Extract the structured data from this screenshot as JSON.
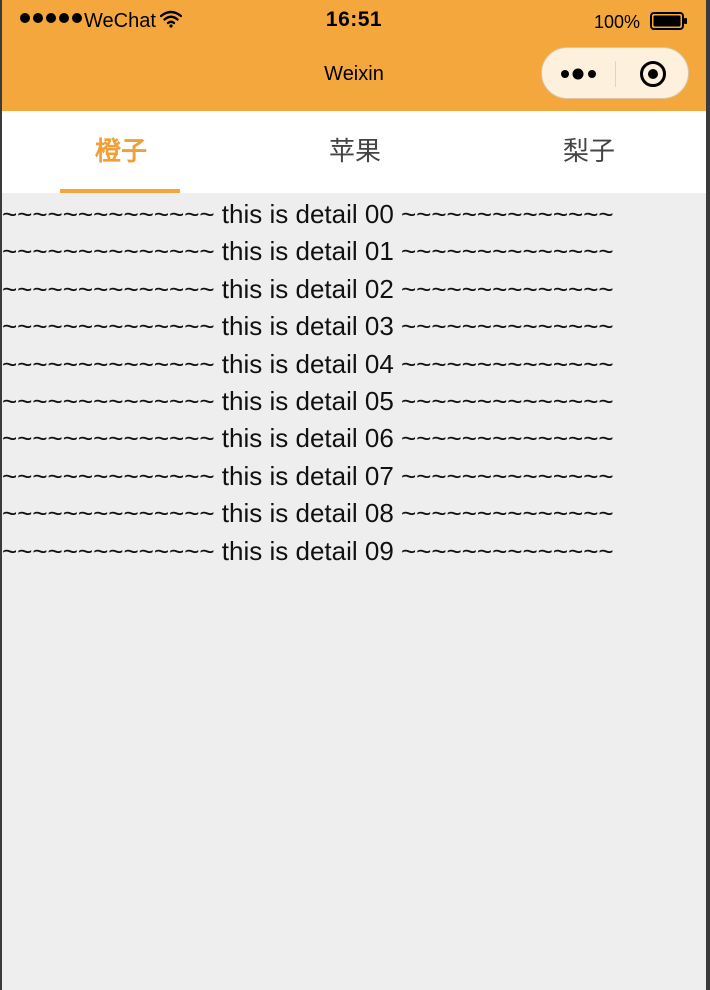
{
  "status_bar": {
    "carrier": "WeChat",
    "time": "16:51",
    "battery": "100%"
  },
  "nav": {
    "title": "Weixin"
  },
  "tabs": [
    {
      "label": "橙子",
      "active": true
    },
    {
      "label": "苹果",
      "active": false
    },
    {
      "label": "梨子",
      "active": false
    }
  ],
  "details": [
    "~~~~~~~~~~~~~~ this is detail 00 ~~~~~~~~~~~~~~",
    "~~~~~~~~~~~~~~ this is detail 01 ~~~~~~~~~~~~~~",
    "~~~~~~~~~~~~~~ this is detail 02 ~~~~~~~~~~~~~~",
    "~~~~~~~~~~~~~~ this is detail 03 ~~~~~~~~~~~~~~",
    "~~~~~~~~~~~~~~ this is detail 04 ~~~~~~~~~~~~~~",
    "~~~~~~~~~~~~~~ this is detail 05 ~~~~~~~~~~~~~~",
    "~~~~~~~~~~~~~~ this is detail 06 ~~~~~~~~~~~~~~",
    "~~~~~~~~~~~~~~ this is detail 07 ~~~~~~~~~~~~~~",
    "~~~~~~~~~~~~~~ this is detail 08 ~~~~~~~~~~~~~~",
    "~~~~~~~~~~~~~~ this is detail 09 ~~~~~~~~~~~~~~"
  ],
  "colors": {
    "accent": "#f3a73c",
    "active_tab_text": "#f0a03a",
    "page_background": "#eeeeee"
  },
  "icons": {
    "signal": "signal-dots-icon",
    "wifi": "wifi-icon",
    "battery": "battery-icon",
    "more": "more-dots-icon",
    "close": "close-miniprogram-icon"
  }
}
